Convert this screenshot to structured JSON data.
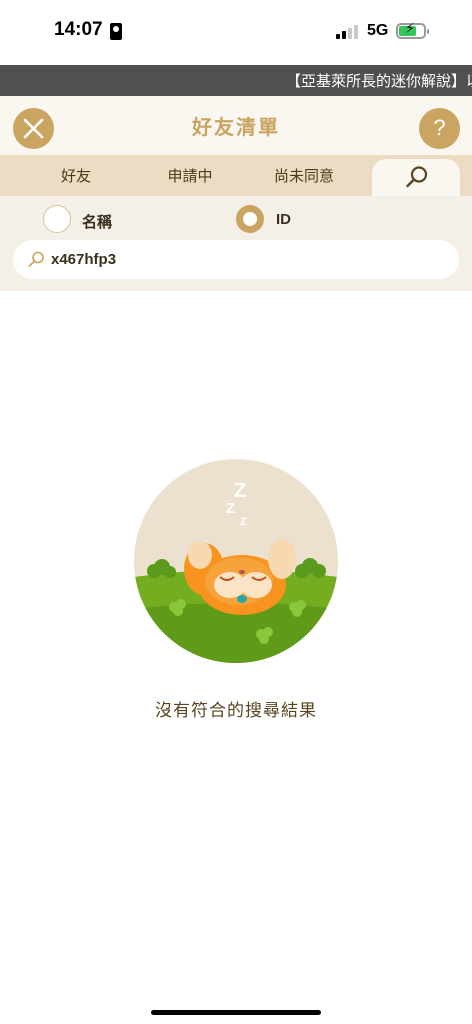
{
  "status_bar": {
    "time": "14:07",
    "network": "5G",
    "battery_level": 0.7,
    "battery_color": "#34c759"
  },
  "banner": {
    "text": "【亞基萊所長的迷你解說】以"
  },
  "header": {
    "title": "好友清單",
    "close_icon": "close-icon",
    "help_label": "?",
    "accent_color": "#caa562"
  },
  "tabs": [
    {
      "label": "好友"
    },
    {
      "label": "申請中"
    },
    {
      "label": "尚未同意"
    },
    {
      "label": "",
      "icon": "search-icon",
      "active": true
    }
  ],
  "filter": {
    "options": [
      {
        "label": "名稱",
        "selected": false
      },
      {
        "label": "ID",
        "selected": true
      }
    ],
    "search_value": "x467hfp3"
  },
  "empty_state": {
    "illustration": "sleeping-character-illustration",
    "message": "沒有符合的搜尋結果"
  }
}
